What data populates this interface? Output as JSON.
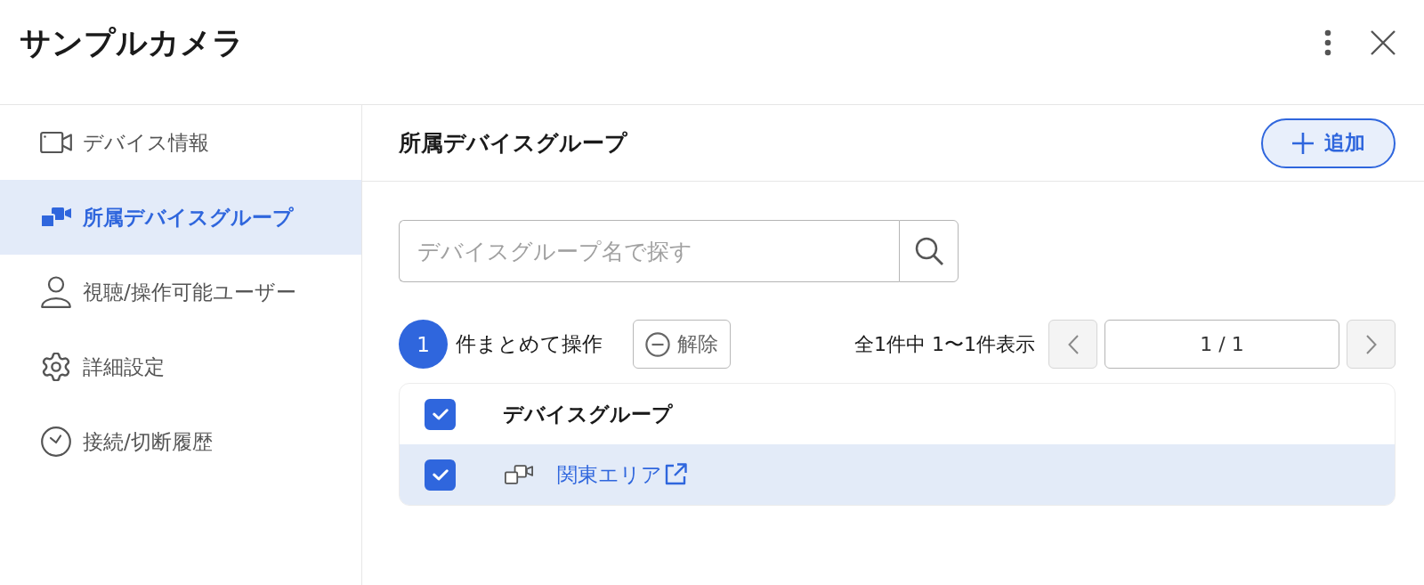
{
  "window": {
    "title": "サンプルカメラ"
  },
  "sidebar": {
    "items": [
      {
        "label": "デバイス情報",
        "selected": false
      },
      {
        "label": "所属デバイスグループ",
        "selected": true
      },
      {
        "label": "視聴/操作可能ユーザー",
        "selected": false
      },
      {
        "label": "詳細設定",
        "selected": false
      },
      {
        "label": "接続/切断履歴",
        "selected": false
      }
    ]
  },
  "panel": {
    "title": "所属デバイスグループ",
    "add_button": "追加"
  },
  "search": {
    "placeholder": "デバイスグループ名で探す"
  },
  "bulk_bar": {
    "count": "1",
    "label": "件まとめて操作",
    "clear_button": "解除"
  },
  "pagination": {
    "summary": "全1件中 1〜1件表示",
    "prev": {
      "disabled": true
    },
    "page": "1 / 1",
    "next": {
      "disabled": true
    }
  },
  "table": {
    "columns": [
      "デバイスグループ"
    ],
    "all_checked": true,
    "rows": [
      {
        "name": "関東エリア",
        "checked": true,
        "selected": true
      }
    ]
  }
}
